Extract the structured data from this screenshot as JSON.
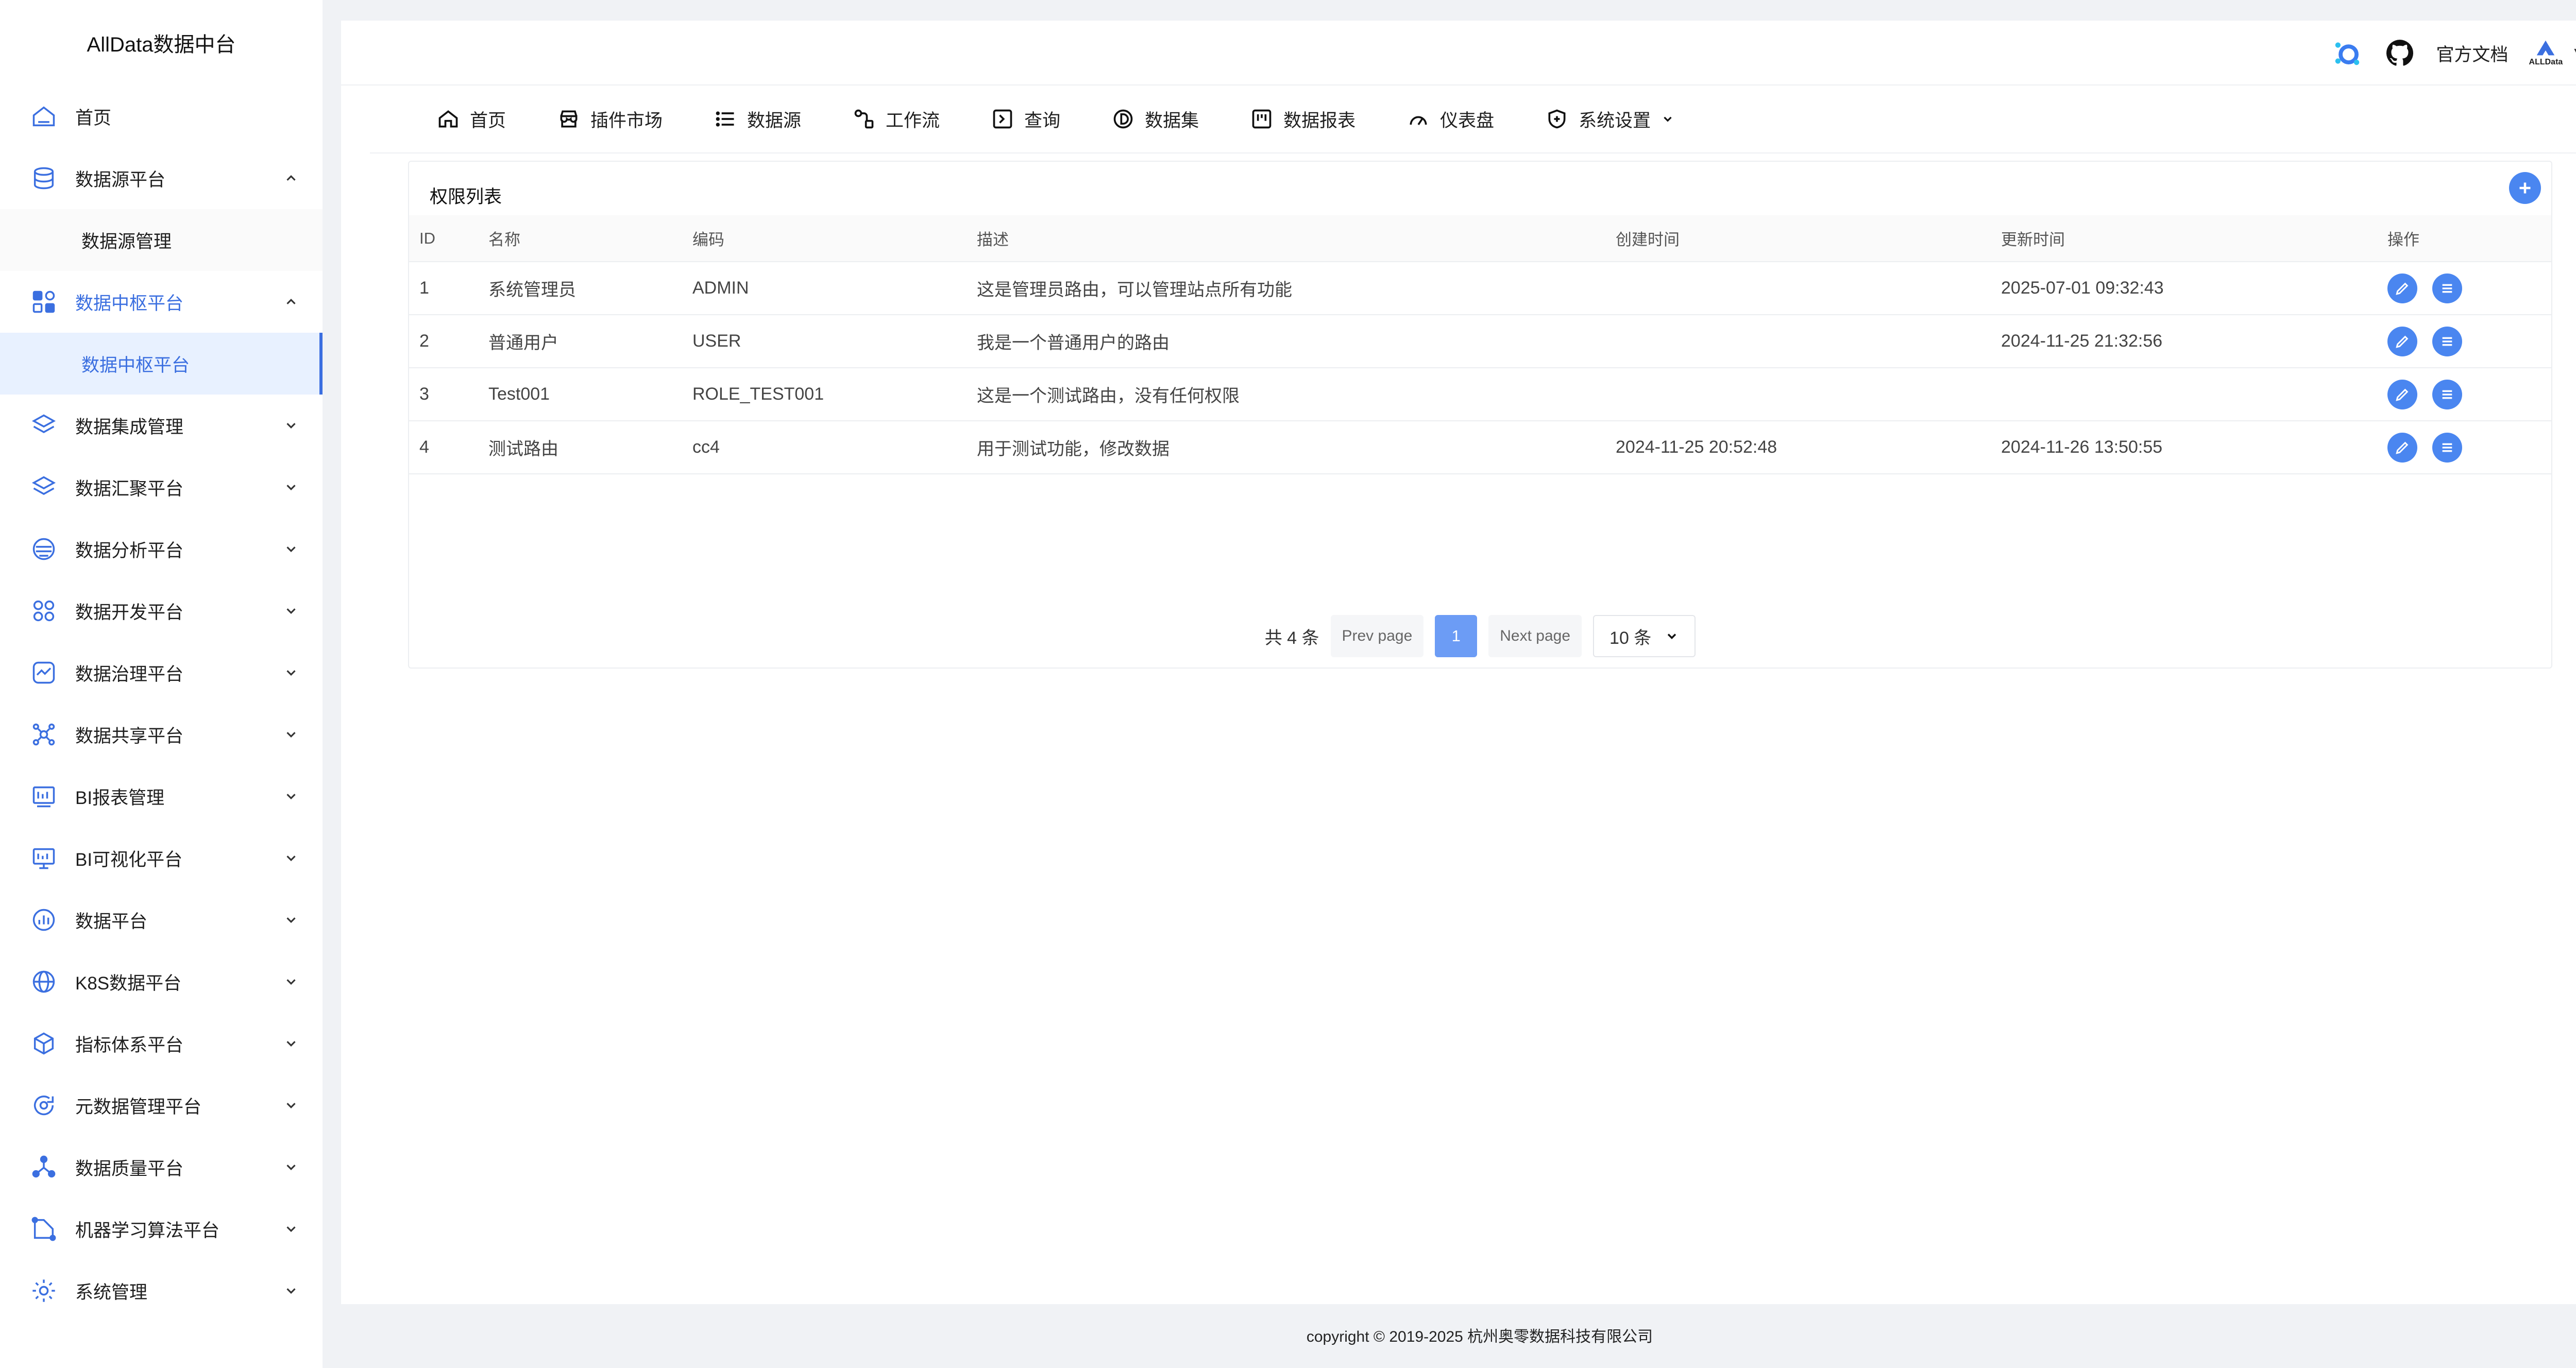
{
  "sidebar": {
    "brand": "AllData数据中台",
    "items": [
      {
        "label": "首页",
        "icon": "home-icon",
        "chevron": ""
      },
      {
        "label": "数据源平台",
        "icon": "database-icon",
        "chevron": "up"
      },
      {
        "label": "数据中枢平台",
        "icon": "apps-icon",
        "chevron": "up",
        "active": true
      },
      {
        "label": "数据集成管理",
        "icon": "layers-icon",
        "chevron": "down"
      },
      {
        "label": "数据汇聚平台",
        "icon": "layers-icon",
        "chevron": "down"
      },
      {
        "label": "数据分析平台",
        "icon": "analysis-icon",
        "chevron": "down"
      },
      {
        "label": "数据开发平台",
        "icon": "grid-icon",
        "chevron": "down"
      },
      {
        "label": "数据治理平台",
        "icon": "governance-icon",
        "chevron": "down"
      },
      {
        "label": "数据共享平台",
        "icon": "share-icon",
        "chevron": "down"
      },
      {
        "label": "BI报表管理",
        "icon": "bi-report-icon",
        "chevron": "down"
      },
      {
        "label": "BI可视化平台",
        "icon": "bi-screen-icon",
        "chevron": "down"
      },
      {
        "label": "数据平台",
        "icon": "chart-icon",
        "chevron": "down"
      },
      {
        "label": "K8S数据平台",
        "icon": "globe-icon",
        "chevron": "down"
      },
      {
        "label": "指标体系平台",
        "icon": "cube-icon",
        "chevron": "down"
      },
      {
        "label": "元数据管理平台",
        "icon": "refresh-icon",
        "chevron": "down"
      },
      {
        "label": "数据质量平台",
        "icon": "nodes-icon",
        "chevron": "down"
      },
      {
        "label": "机器学习算法平台",
        "icon": "ml-icon",
        "chevron": "down"
      },
      {
        "label": "系统管理",
        "icon": "gear-icon",
        "chevron": "down"
      }
    ],
    "submenus": {
      "datasource": "数据源管理",
      "hub": "数据中枢平台"
    }
  },
  "header": {
    "docs_label": "官方文档",
    "logo_text": "ALLData",
    "caret": "▼"
  },
  "topnav": [
    {
      "label": "首页",
      "icon": "home-icon"
    },
    {
      "label": "插件市场",
      "icon": "store-icon"
    },
    {
      "label": "数据源",
      "icon": "list-icon"
    },
    {
      "label": "工作流",
      "icon": "workflow-icon"
    },
    {
      "label": "查询",
      "icon": "query-icon"
    },
    {
      "label": "数据集",
      "icon": "dataset-icon"
    },
    {
      "label": "数据报表",
      "icon": "report-icon"
    },
    {
      "label": "仪表盘",
      "icon": "gauge-icon"
    },
    {
      "label": "系统设置",
      "icon": "shield-icon",
      "dropdown": true
    }
  ],
  "card": {
    "title": "权限列表",
    "columns": [
      "ID",
      "名称",
      "编码",
      "描述",
      "创建时间",
      "更新时间",
      "操作"
    ],
    "rows": [
      {
        "id": "1",
        "name": "系统管理员",
        "code": "ADMIN",
        "desc": "这是管理员路由，可以管理站点所有功能",
        "created": "",
        "updated": "2025-07-01 09:32:43"
      },
      {
        "id": "2",
        "name": "普通用户",
        "code": "USER",
        "desc": "我是一个普通用户的路由",
        "created": "",
        "updated": "2024-11-25 21:32:56"
      },
      {
        "id": "3",
        "name": "Test001",
        "code": "ROLE_TEST001",
        "desc": "这是一个测试路由，没有任何权限",
        "created": "",
        "updated": ""
      },
      {
        "id": "4",
        "name": "测试路由",
        "code": "cc4",
        "desc": "用于测试功能，修改数据",
        "created": "2024-11-25 20:52:48",
        "updated": "2024-11-26 13:50:55"
      }
    ]
  },
  "pager": {
    "total": "共 4 条",
    "prev": "Prev page",
    "current": "1",
    "next": "Next page",
    "page_size": "10 条"
  },
  "footer": "copyright © 2019-2025 杭州奥零数据科技有限公司",
  "colors": {
    "accent": "#3b6fe0",
    "button": "#4a86f0",
    "page_active": "#6c9cf5"
  }
}
